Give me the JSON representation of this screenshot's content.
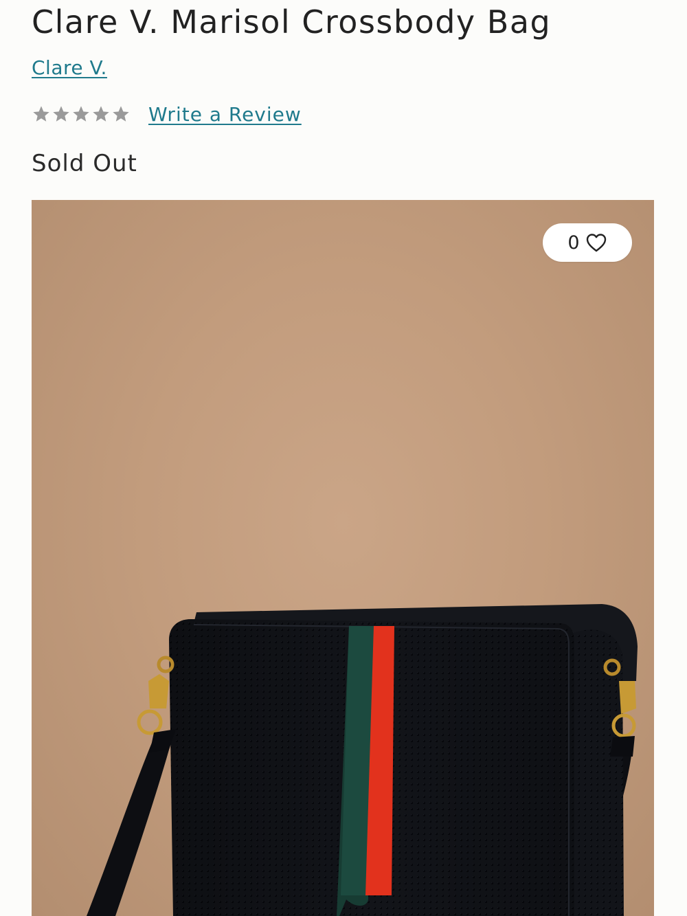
{
  "product": {
    "title": "Clare V. Marisol Crossbody Bag",
    "brand": "Clare V.",
    "rating": {
      "value": 0,
      "max": 5
    },
    "review_link": "Write a Review",
    "availability": "Sold Out"
  },
  "wishlist": {
    "count": "0",
    "icon": "heart-outline-icon"
  },
  "colors": {
    "link": "#1f7a8c",
    "star": "#9a9a9a"
  }
}
